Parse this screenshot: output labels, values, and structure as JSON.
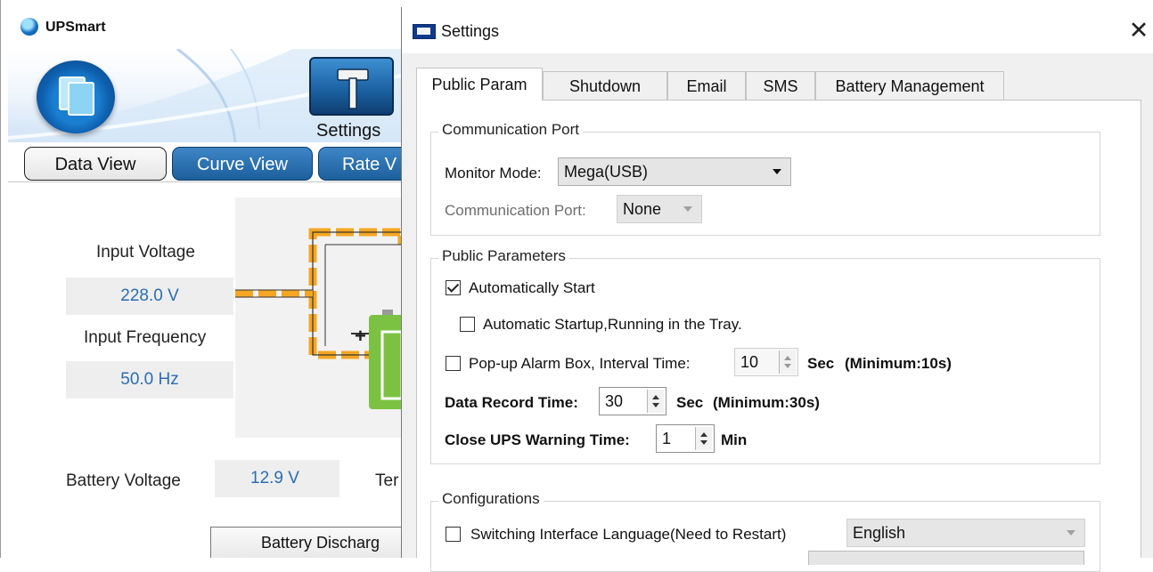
{
  "main_window": {
    "title": "UPSmart",
    "toolbar": {
      "settings_label": "Settings"
    },
    "view_tabs": [
      "Data View",
      "Curve View",
      "Rate V"
    ],
    "input_voltage": {
      "label": "Input Voltage",
      "value": "228.0 V"
    },
    "input_frequency": {
      "label": "Input Frequency",
      "value": "50.0 Hz"
    },
    "battery_voltage": {
      "label": "Battery Voltage",
      "value": "12.9 V"
    },
    "temperature_label_clipped": "Ter",
    "battery_discharge_header": "Battery Discharg",
    "battery_polarity": "+",
    "colors": {
      "accent_blue": "#1d5f9d",
      "value_text": "#2a6db5",
      "flow_orange": "#f5a623",
      "battery_green": "#7cc242"
    }
  },
  "dialog": {
    "title": "Settings",
    "close_glyph": "✕",
    "tabs": [
      "Public Param",
      "Shutdown",
      "Email",
      "SMS",
      "Battery Management"
    ],
    "active_tab": "Public Param",
    "communication_port_group": {
      "title": "Communication Port",
      "monitor_mode_label": "Monitor Mode:",
      "monitor_mode_value": "Mega(USB)",
      "comm_port_label": "Communication Port:",
      "comm_port_value": "None"
    },
    "public_parameters_group": {
      "title": "Public Parameters",
      "auto_start": {
        "label": "Automatically Start",
        "checked": true
      },
      "auto_startup_tray": {
        "label": "Automatic Startup,Running in the Tray.",
        "checked": false
      },
      "popup_alarm": {
        "label": "Pop-up Alarm Box, Interval Time:",
        "checked": false,
        "value": "10",
        "unit": "Sec",
        "hint": "(Minimum:10s)"
      },
      "data_record": {
        "label": "Data Record Time:",
        "value": "30",
        "unit": "Sec",
        "hint": "(Minimum:30s)"
      },
      "close_ups_warning": {
        "label": "Close UPS Warning Time:",
        "value": "1",
        "unit": "Min"
      }
    },
    "configurations_group": {
      "title": "Configurations",
      "switch_language": {
        "label": "Switching Interface Language(Need to Restart)",
        "checked": false,
        "value": "English"
      }
    }
  }
}
